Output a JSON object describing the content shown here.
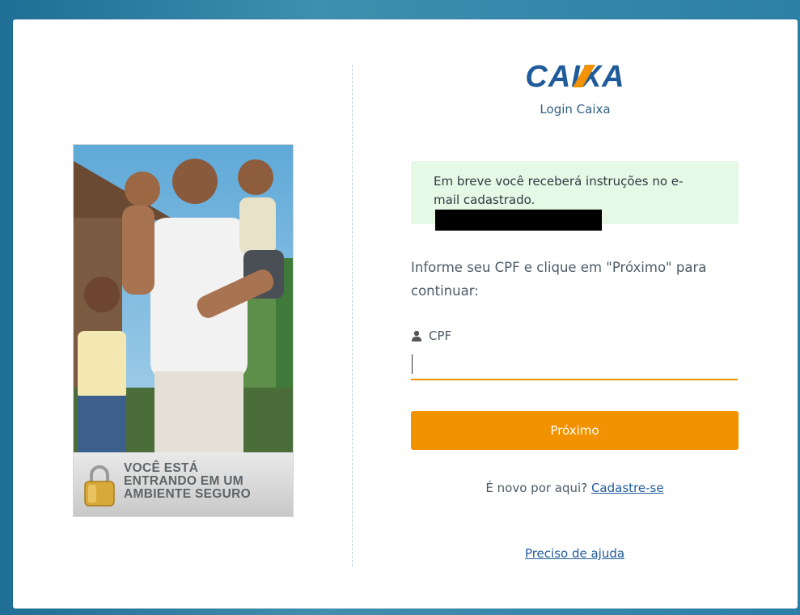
{
  "brand": {
    "logo_text": "CAIXA",
    "subtitle": "Login Caixa",
    "primary_color": "#1f5b9a",
    "accent_color": "#f39200"
  },
  "promo": {
    "banner_lines": [
      "VOCÊ ESTÁ",
      "ENTRANDO EM UM",
      "AMBIENTE SEGURO"
    ]
  },
  "notice": {
    "text": "Em breve você receberá instruções no e-mail cadastrado.",
    "background": "#e6f8e6"
  },
  "form": {
    "instructions": "Informe seu CPF e clique em \"Próximo\" para continuar:",
    "cpf_label": "CPF",
    "cpf_icon": "user-icon",
    "cpf_value": "",
    "next_label": "Próximo"
  },
  "footer": {
    "signup_prompt": "É novo por aqui?",
    "signup_link": "Cadastre-se",
    "help_link": "Preciso de ajuda"
  }
}
